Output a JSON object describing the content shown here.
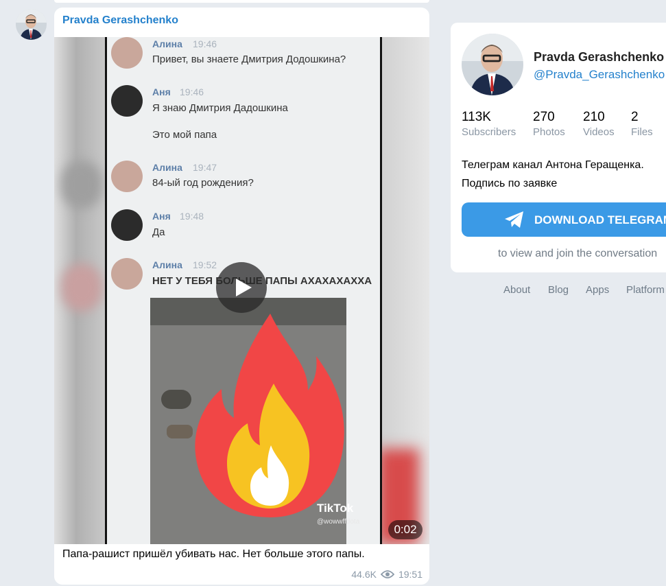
{
  "post": {
    "author": "Pravda Gerashchenko",
    "caption": "Папа-рашист пришёл убивать нас. Нет больше этого папы.",
    "views": "44.6K",
    "time": "19:51",
    "video": {
      "duration": "0:02",
      "watermark": "TikTok",
      "watermark_handle": "@wowwffdota"
    },
    "chat": [
      {
        "name": "Алина",
        "time": "19:46",
        "text": "Привет, вы знаете Дмитрия Додошкина?"
      },
      {
        "name": "Аня",
        "time": "19:46",
        "text": "Я знаю Дмитрия Дадошкина",
        "text2": "Это мой папа"
      },
      {
        "name": "Алина",
        "time": "19:47",
        "text": "84-ый год рождения?"
      },
      {
        "name": "Аня",
        "time": "19:48",
        "text": "Да"
      },
      {
        "name": "Алина",
        "time": "19:52",
        "text": "НЕТ У ТЕБЯ БОЛЬШЕ ПАПЫ АХАХАХАХХА"
      }
    ]
  },
  "channel": {
    "name": "Pravda Gerashchenko",
    "username": "@Pravda_Gerashchenko",
    "stats": [
      {
        "value": "113K",
        "label": "Subscribers"
      },
      {
        "value": "270",
        "label": "Photos"
      },
      {
        "value": "210",
        "label": "Videos"
      },
      {
        "value": "2",
        "label": "Files"
      }
    ],
    "description_line1": "Телеграм канал Антона Геращенка.",
    "description_line2": "Подпись по заявке",
    "download_button": "DOWNLOAD TELEGRAM",
    "join_text": "to view and join the conversation"
  },
  "footer": {
    "links": [
      "About",
      "Blog",
      "Apps",
      "Platform"
    ]
  },
  "colors": {
    "accent": "#2481cc",
    "button": "#3b9ae6",
    "background": "#e7ebf0"
  }
}
